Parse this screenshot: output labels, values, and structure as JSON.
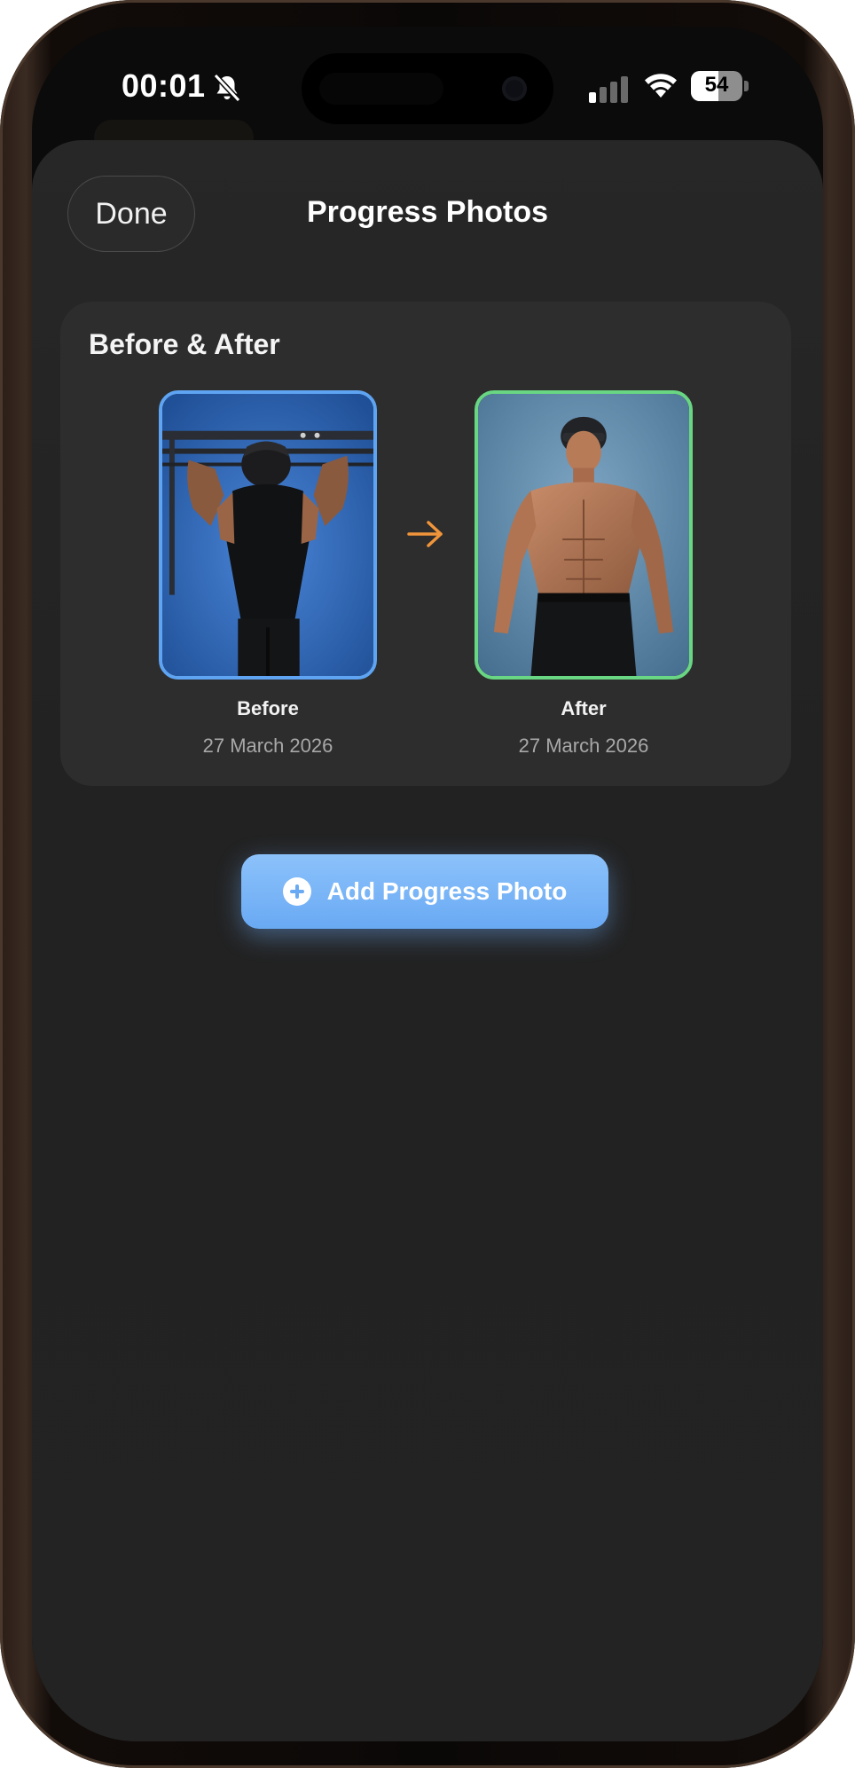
{
  "status_bar": {
    "time": "00:01",
    "battery_percent": "54",
    "silent_icon": "bell-slash-icon",
    "signal_icon": "cellular-signal-icon",
    "wifi_icon": "wifi-icon"
  },
  "header": {
    "done_label": "Done",
    "title": "Progress Photos"
  },
  "comparison": {
    "section_title": "Before & After",
    "before": {
      "label": "Before",
      "date": "27 March 2026",
      "border_color": "#5ea4f2"
    },
    "after": {
      "label": "After",
      "date": "27 March 2026",
      "border_color": "#69d683"
    },
    "arrow_icon": "arrow-right-icon",
    "arrow_color": "#f0953a"
  },
  "actions": {
    "add_photo_label": "Add Progress Photo",
    "add_photo_icon": "plus-circle-icon",
    "button_color": "#6aaaf3"
  },
  "theme": {
    "sheet_background": "#232323",
    "card_background": "#2d2d2d"
  }
}
